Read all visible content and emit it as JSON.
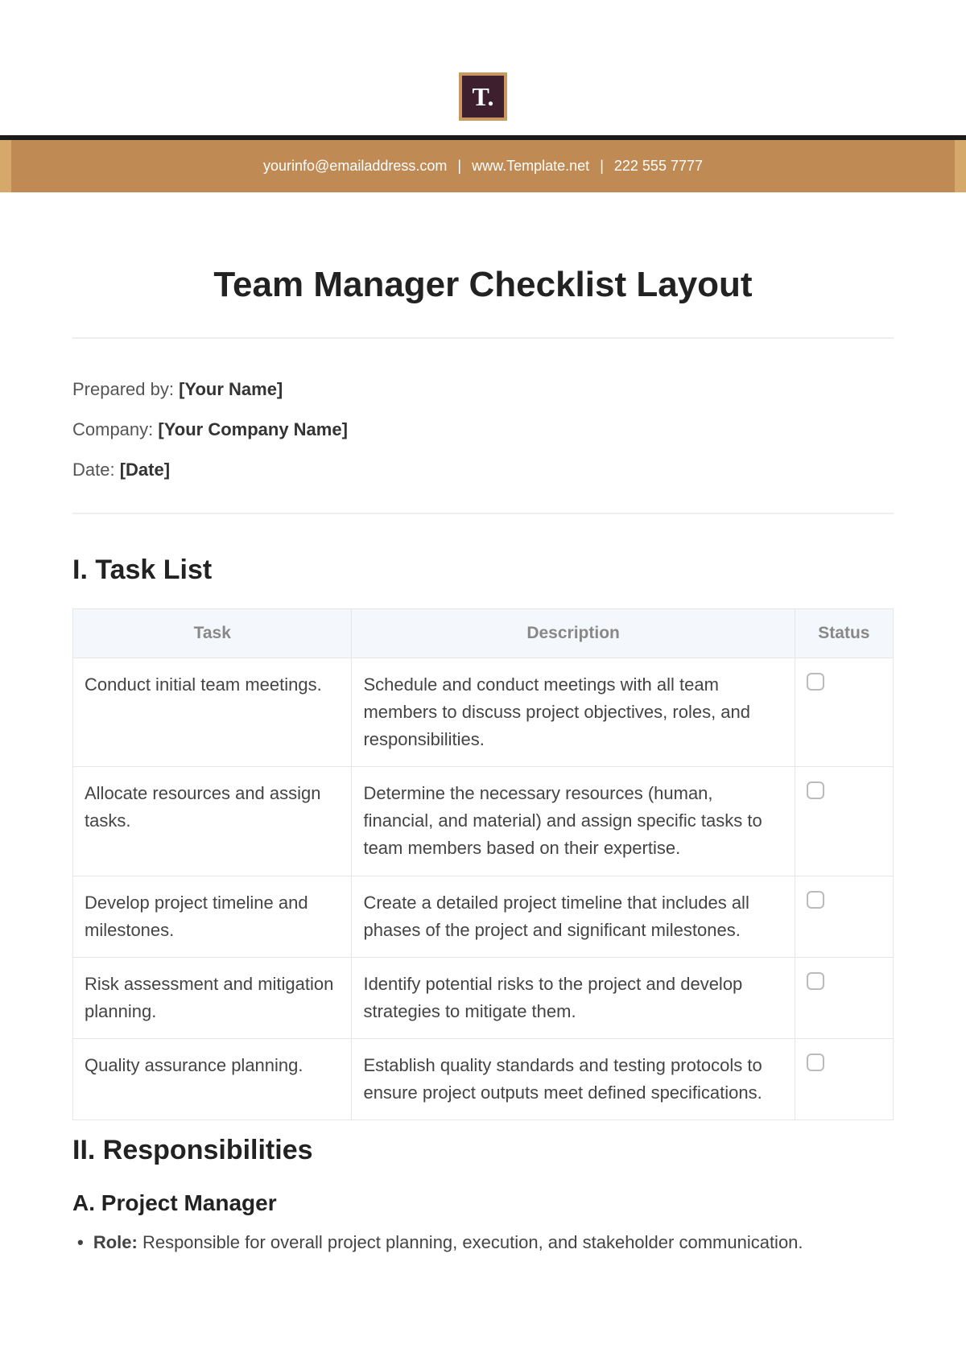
{
  "logo_text": "T.",
  "banner": {
    "email": "yourinfo@emailaddress.com",
    "website": "www.Template.net",
    "phone": "222 555 7777"
  },
  "title": "Team Manager Checklist Layout",
  "meta": {
    "prepared_label": "Prepared by:",
    "prepared_value": "[Your Name]",
    "company_label": "Company:",
    "company_value": "[Your Company Name]",
    "date_label": "Date:",
    "date_value": "[Date]"
  },
  "sections": {
    "tasklist_heading": "I. Task List",
    "responsibilities_heading": "II. Responsibilities",
    "pm_subheading": "A. Project Manager"
  },
  "table": {
    "headers": {
      "task": "Task",
      "description": "Description",
      "status": "Status"
    },
    "rows": [
      {
        "task": "Conduct initial team meetings.",
        "description": "Schedule and conduct meetings with all team members to discuss project objectives, roles, and responsibilities."
      },
      {
        "task": "Allocate resources and assign tasks.",
        "description": "Determine the necessary resources (human, financial, and material) and assign specific tasks to team members based on their expertise."
      },
      {
        "task": "Develop project timeline and milestones.",
        "description": "Create a detailed project timeline that includes all phases of the project and significant milestones."
      },
      {
        "task": "Risk assessment and mitigation planning.",
        "description": "Identify potential risks to the project and develop strategies to mitigate them."
      },
      {
        "task": "Quality assurance planning.",
        "description": "Establish quality standards and testing protocols to ensure project outputs meet defined specifications."
      }
    ]
  },
  "responsibilities": {
    "role_label": "Role:",
    "role_text": " Responsible for overall project planning, execution, and stakeholder communication."
  }
}
